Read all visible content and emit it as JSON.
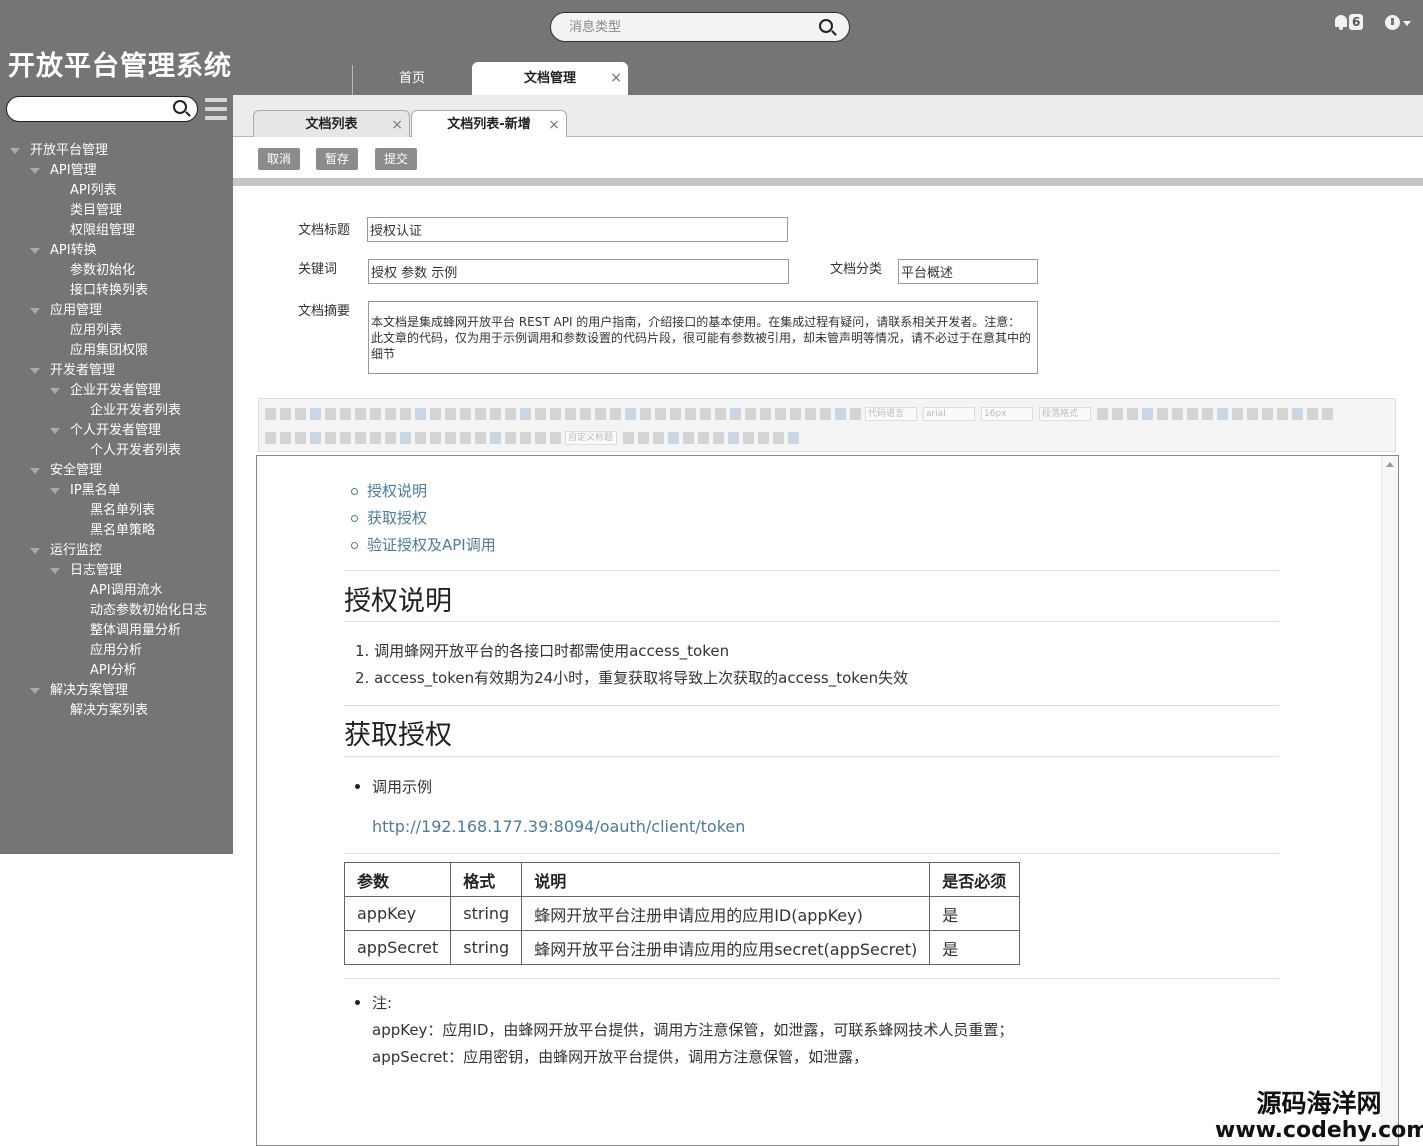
{
  "app": {
    "title": "开放平台管理系统"
  },
  "header": {
    "search": {
      "placeholder": "消息类型"
    },
    "notifications": {
      "count": "6"
    },
    "tabs": [
      {
        "label": "首页"
      },
      {
        "label": "文档管理",
        "close": "×"
      }
    ]
  },
  "sidebar": {
    "search": {
      "placeholder": ""
    },
    "tree": [
      {
        "label": "开放平台管理",
        "level": 0,
        "expanded": true
      },
      {
        "label": "API管理",
        "level": 1,
        "expanded": true
      },
      {
        "label": "API列表",
        "level": 2
      },
      {
        "label": "类目管理",
        "level": 2
      },
      {
        "label": "权限组管理",
        "level": 2
      },
      {
        "label": "API转换",
        "level": 1,
        "expanded": true
      },
      {
        "label": "参数初始化",
        "level": 2
      },
      {
        "label": "接口转换列表",
        "level": 2
      },
      {
        "label": "应用管理",
        "level": 1,
        "expanded": true
      },
      {
        "label": "应用列表",
        "level": 2
      },
      {
        "label": "应用集团权限",
        "level": 2
      },
      {
        "label": "开发者管理",
        "level": 1,
        "expanded": true
      },
      {
        "label": "企业开发者管理",
        "level": 2,
        "expanded": true
      },
      {
        "label": "企业开发者列表",
        "level": 3
      },
      {
        "label": "个人开发者管理",
        "level": 2,
        "expanded": true
      },
      {
        "label": "个人开发者列表",
        "level": 3
      },
      {
        "label": "安全管理",
        "level": 1,
        "expanded": true
      },
      {
        "label": "IP黑名单",
        "level": 2,
        "expanded": true
      },
      {
        "label": "黑名单列表",
        "level": 3
      },
      {
        "label": "黑名单策略",
        "level": 3
      },
      {
        "label": "运行监控",
        "level": 1,
        "expanded": true
      },
      {
        "label": "日志管理",
        "level": 2,
        "expanded": true
      },
      {
        "label": "API调用流水",
        "level": 3
      },
      {
        "label": "动态参数初始化日志",
        "level": 3
      },
      {
        "label": "整体调用量分析",
        "level": 3
      },
      {
        "label": "应用分析",
        "level": 3
      },
      {
        "label": "API分析",
        "level": 3
      },
      {
        "label": "解决方案管理",
        "level": 1,
        "expanded": true
      },
      {
        "label": "解决方案列表",
        "level": 2
      }
    ]
  },
  "subtabs": [
    {
      "label": "文档列表",
      "close": "×"
    },
    {
      "label": "文档列表-新增",
      "close": "×"
    }
  ],
  "actions": {
    "cancel": "取消",
    "save": "暂存",
    "submit": "提交"
  },
  "form": {
    "title_label": "文档标题",
    "title_value": "授权认证",
    "keywords_label": "关键词",
    "keywords_value": "授权 参数 示例",
    "category_label": "文档分类",
    "category_value": "平台概述",
    "summary_label": "文档摘要",
    "summary_value": "本文档是集成蜂网开放平台 REST API 的用户指南，介绍接口的基本使用。在集成过程有疑问，请联系相关开发者。注意： 此文章的代码，仅为用于示例调用和参数设置的代码片段，很可能有参数被引用，却未管声明等情况，请不必过于在意其中的细节"
  },
  "editor": {
    "toolbar_selects": [
      "代码语言",
      "arial",
      "16px",
      "段落格式",
      "自定义标题"
    ],
    "toc": [
      "授权说明",
      "获取授权",
      "验证授权及API调用"
    ],
    "section1": {
      "heading": "授权说明",
      "items": [
        "调用蜂网开放平台的各接口时都需使用access_token",
        "access_token有效期为24小时，重复获取将导致上次获取的access_token失效"
      ]
    },
    "section2": {
      "heading": "获取授权",
      "bullet": "调用示例",
      "url": "http://192.168.177.39:8094/oauth/client/token",
      "table": {
        "headers": [
          "参数",
          "格式",
          "说明",
          "是否必须"
        ],
        "rows": [
          [
            "appKey",
            "string",
            "蜂网开放平台注册申请应用的应用ID(appKey)",
            "是"
          ],
          [
            "appSecret",
            "string",
            "蜂网开放平台注册申请应用的应用secret(appSecret)",
            "是"
          ]
        ]
      },
      "note_label": "注:",
      "note_lines": [
        "appKey：应用ID，由蜂网开放平台提供，调用方注意保管，如泄露，可联系蜂网技术人员重置；",
        "appSecret：应用密钥，由蜂网开放平台提供，调用方注意保管，如泄露，"
      ]
    }
  },
  "watermark": {
    "name": "源码海洋网",
    "url": "www.codehy.com"
  }
}
